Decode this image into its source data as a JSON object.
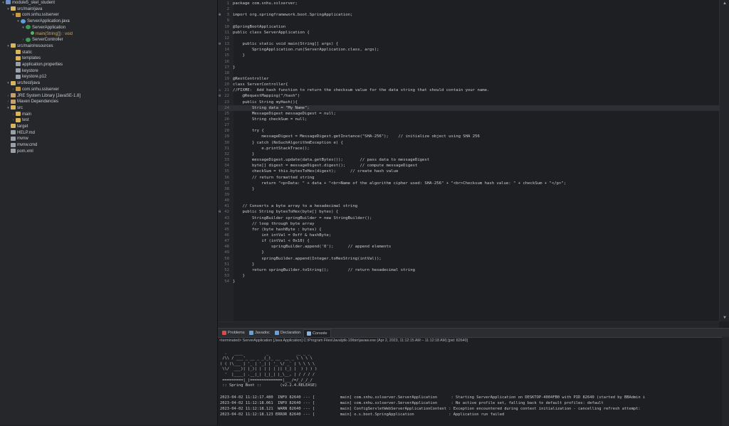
{
  "explorer": {
    "rows": [
      {
        "indent": 0,
        "arrow": "v",
        "icon": "project",
        "label": "module5_skel_student"
      },
      {
        "indent": 1,
        "arrow": "v",
        "icon": "folder",
        "label": "src/main/java"
      },
      {
        "indent": 2,
        "arrow": "v",
        "icon": "pkg",
        "label": "com.snhu.sslserver"
      },
      {
        "indent": 3,
        "arrow": "v",
        "icon": "java",
        "label": "ServerApplication.java"
      },
      {
        "indent": 4,
        "arrow": "v",
        "icon": "cls",
        "label": "ServerApplication"
      },
      {
        "indent": 5,
        "arrow": "",
        "icon": "method",
        "label": "main(String[]) : void"
      },
      {
        "indent": 4,
        "arrow": ">",
        "icon": "cls",
        "label": "ServerController"
      },
      {
        "indent": 1,
        "arrow": "v",
        "icon": "folder",
        "label": "src/main/resources"
      },
      {
        "indent": 2,
        "arrow": "",
        "icon": "folder",
        "label": "static"
      },
      {
        "indent": 2,
        "arrow": "",
        "icon": "folder",
        "label": "templates"
      },
      {
        "indent": 2,
        "arrow": "",
        "icon": "file",
        "label": "application.properties"
      },
      {
        "indent": 2,
        "arrow": "",
        "icon": "file",
        "label": "keystore"
      },
      {
        "indent": 2,
        "arrow": "",
        "icon": "file",
        "label": "keystore.p12"
      },
      {
        "indent": 1,
        "arrow": "v",
        "icon": "folder",
        "label": "src/test/java"
      },
      {
        "indent": 2,
        "arrow": ">",
        "icon": "pkg",
        "label": "com.snhu.sslserver"
      },
      {
        "indent": 1,
        "arrow": ">",
        "icon": "lib",
        "label": "JRE System Library [JavaSE-1.8]"
      },
      {
        "indent": 1,
        "arrow": ">",
        "icon": "lib",
        "label": "Maven Dependencies"
      },
      {
        "indent": 1,
        "arrow": "v",
        "icon": "folder",
        "label": "src"
      },
      {
        "indent": 2,
        "arrow": ">",
        "icon": "folder",
        "label": "main"
      },
      {
        "indent": 2,
        "arrow": ">",
        "icon": "folder",
        "label": "test"
      },
      {
        "indent": 1,
        "arrow": "",
        "icon": "folder",
        "label": "target"
      },
      {
        "indent": 1,
        "arrow": "",
        "icon": "file",
        "label": "HELP.md"
      },
      {
        "indent": 1,
        "arrow": "",
        "icon": "file",
        "label": "mvnw"
      },
      {
        "indent": 1,
        "arrow": "",
        "icon": "file",
        "label": "mvnw.cmd"
      },
      {
        "indent": 1,
        "arrow": "",
        "icon": "file",
        "label": "pom.xml"
      }
    ]
  },
  "editor": {
    "lines": [
      {
        "n": "1",
        "t": "package com.snhu.sslserver;"
      },
      {
        "n": "2",
        "t": ""
      },
      {
        "n": "3",
        "t": "import org.springframework.boot.SpringApplication;",
        "mark": "+"
      },
      {
        "n": "9",
        "t": ""
      },
      {
        "n": "10",
        "t": "@SpringBootApplication"
      },
      {
        "n": "11",
        "t": "public class ServerApplication {"
      },
      {
        "n": "12",
        "t": ""
      },
      {
        "n": "13",
        "t": "    public static void main(String[] args) {",
        "mark": "-"
      },
      {
        "n": "14",
        "t": "        SpringApplication.run(ServerApplication.class, args);"
      },
      {
        "n": "15",
        "t": "    }"
      },
      {
        "n": "16",
        "t": ""
      },
      {
        "n": "17",
        "t": "}"
      },
      {
        "n": "18",
        "t": ""
      },
      {
        "n": "19",
        "t": "@RestController"
      },
      {
        "n": "20",
        "t": "class ServerController{"
      },
      {
        "n": "21",
        "t": "//FIXME:  Add hash function to return the checksum value for the data string that should contain your name.",
        "mark": "!"
      },
      {
        "n": "22",
        "t": "    @RequestMapping(\"/hash\")",
        "mark": "-"
      },
      {
        "n": "23",
        "t": "    public String myHash(){"
      },
      {
        "n": "24",
        "t": "        String data = \"My Name\";",
        "hl": true
      },
      {
        "n": "25",
        "t": "        MessageDigest messageDigest = null;"
      },
      {
        "n": "26",
        "t": "        String checkSum = null;"
      },
      {
        "n": "27",
        "t": ""
      },
      {
        "n": "28",
        "t": "        try {"
      },
      {
        "n": "29",
        "t": "            messageDigest = MessageDigest.getInstance(\"SHA-256\");    // initialize object using SHA 256"
      },
      {
        "n": "30",
        "t": "        } catch (NoSuchAlgorithmException e) {"
      },
      {
        "n": "31",
        "t": "            e.printStackTrace();"
      },
      {
        "n": "32",
        "t": "        }"
      },
      {
        "n": "33",
        "t": "        messageDigest.update(data.getBytes());       // pass data to messageDigest"
      },
      {
        "n": "34",
        "t": "        byte[] digest = messageDigest.digest();      // compute messageDigest"
      },
      {
        "n": "35",
        "t": "        checkSum = this.bytesToHex(digest);      // create hash value"
      },
      {
        "n": "36",
        "t": "        // return formatted string"
      },
      {
        "n": "37",
        "t": "            return \"<p>Data: \" + data + \"<br>Name of the algorithm cipher used: SHA-256\" + \"<br>Checksum hash value: \" + checkSum + \"</p>\";"
      },
      {
        "n": "38",
        "t": "        }"
      },
      {
        "n": "39",
        "t": ""
      },
      {
        "n": "40",
        "t": ""
      },
      {
        "n": "41",
        "t": "    // Converts a byte array to a hexadecimal string"
      },
      {
        "n": "42",
        "t": "    public String bytesToHex(byte[] bytes) {",
        "mark": "-"
      },
      {
        "n": "43",
        "t": "        StringBuilder springBuilder = new StringBuilder();"
      },
      {
        "n": "44",
        "t": "        // loop through byte array"
      },
      {
        "n": "45",
        "t": "        for (byte hashByte : bytes) {"
      },
      {
        "n": "46",
        "t": "            int intVal = 0xff & hashByte;"
      },
      {
        "n": "47",
        "t": "            if (intVal < 0x10) {"
      },
      {
        "n": "48",
        "t": "                springBuilder.append('0');      // append elements"
      },
      {
        "n": "49",
        "t": "            }"
      },
      {
        "n": "50",
        "t": "            springBuilder.append(Integer.toHexString(intVal));"
      },
      {
        "n": "51",
        "t": "        }"
      },
      {
        "n": "52",
        "t": "        return springBuilder.toString();        // return hexadecimal string"
      },
      {
        "n": "53",
        "t": "    }"
      },
      {
        "n": "54",
        "t": "}"
      }
    ]
  },
  "panel": {
    "tabs": [
      {
        "label": "Problems",
        "color": "#d05050",
        "active": false
      },
      {
        "label": "Javadoc",
        "color": "#6a9fd8",
        "active": false
      },
      {
        "label": "Declaration",
        "color": "#6a9fd8",
        "active": false
      },
      {
        "label": "Console",
        "color": "#8fb0d8",
        "active": true
      }
    ],
    "terminated": "<terminated> ServerApplication [Java Application] C:\\Program Files\\Java\\jdk-19\\bin\\javaw.exe  (Apr 2, 2023, 11:12:15 AM – 11:12:18 AM) [pid: 82640]",
    "console": [
      "",
      "  .   ____          _            __ _ _",
      " /\\\\ / ___'_ __ _ _(_)_ __  __ _ \\ \\ \\ \\",
      "( ( )\\___ | '_ | '_| | '_ \\/ _` | \\ \\ \\ \\",
      " \\\\/  ___)| |_)| | | | | || (_| |  ) ) ) )",
      "  '  |____| .__|_| |_|_| |_\\__, | / / / /",
      " =========|_|==============|___/=/_/_/_/",
      " :: Spring Boot ::        (v2.2.4.RELEASE)",
      "",
      "2023-04-02 11:12:17.480  INFO 82640 --- [           main] com.snhu.sslserver.ServerApplication      : Starting ServerApplication on DESKTOP-4004FB0 with PID 82640 (started by BBAdmin i",
      "2023-04-02 11:12:18.061  INFO 82640 --- [           main] com.snhu.sslserver.ServerApplication      : No active profile set, falling back to default profiles: default",
      "2023-04-02 11:12:18.121  WARN 82640 --- [           main] ConfigServletWebServerApplicationContext : Exception encountered during context initialization - cancelling refresh attempt:",
      "2023-04-02 11:12:18.123 ERROR 82640 --- [           main] o.s.boot.SpringApplication               : Application run failed"
    ]
  },
  "scroll": {
    "up": "▲",
    "down": "▼"
  }
}
